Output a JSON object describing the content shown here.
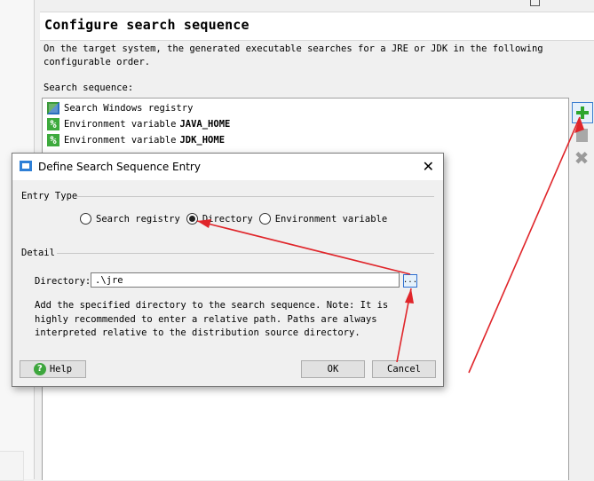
{
  "page": {
    "title": "Configure search sequence",
    "description": "On the target system, the generated executable searches for a JRE or JDK in the following configurable order.",
    "sequence_label": "Search sequence:"
  },
  "sequence": {
    "items": [
      {
        "prefix": "Search Windows registry",
        "bold": "",
        "icon": "registry-icon"
      },
      {
        "prefix": "Environment variable",
        "bold": "JAVA_HOME",
        "icon": "percent-icon"
      },
      {
        "prefix": "Environment variable",
        "bold": "JDK_HOME",
        "icon": "percent-icon"
      }
    ]
  },
  "side_buttons": {
    "add": "plus-icon",
    "edit": "edit-icon",
    "delete": "delete-icon"
  },
  "dialog": {
    "title": "Define Search Sequence Entry",
    "close": "✕",
    "entry_type_label": "Entry Type",
    "radios": [
      {
        "label": "Search registry",
        "selected": false
      },
      {
        "label": "Directory",
        "selected": true
      },
      {
        "label": "Environment variable",
        "selected": false
      }
    ],
    "detail_label": "Detail",
    "directory_label": "Directory:",
    "directory_value": ".\\jre",
    "browse_label": "...",
    "detail_text": "Add the specified directory to the search sequence. Note: It is highly recommended to enter a relative path. Paths are always interpreted relative to the distribution source directory.",
    "help_label": "Help",
    "ok_label": "OK",
    "cancel_label": "Cancel"
  },
  "colors": {
    "annotation_arrow": "#e0252a",
    "accent_blue": "#2e7fd6",
    "add_green": "#2ea62e"
  }
}
